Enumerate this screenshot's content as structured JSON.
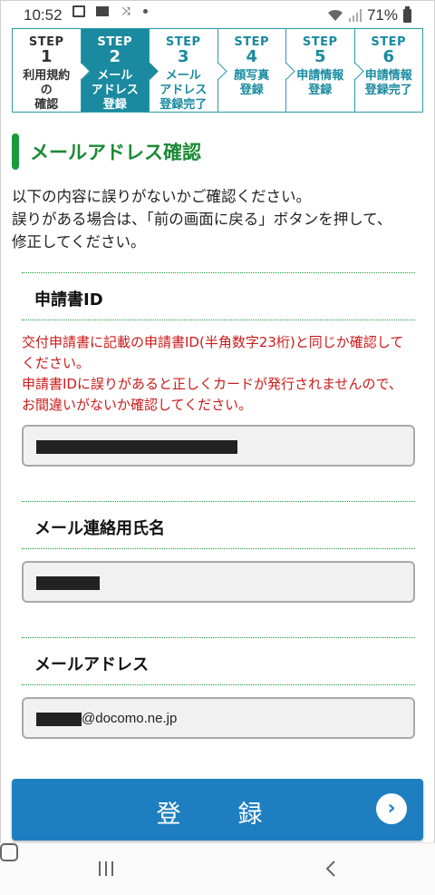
{
  "status": {
    "time": "10:52",
    "battery": "71%"
  },
  "steps": [
    {
      "label": "STEP",
      "number": "1",
      "text": [
        "利用規約",
        "の",
        "確認"
      ]
    },
    {
      "label": "STEP",
      "number": "2",
      "text": [
        "メール",
        "アドレス",
        "登録"
      ]
    },
    {
      "label": "STEP",
      "number": "3",
      "text": [
        "メール",
        "アドレス",
        "登録完了"
      ]
    },
    {
      "label": "STEP",
      "number": "4",
      "text": [
        "顔写真",
        "登録"
      ]
    },
    {
      "label": "STEP",
      "number": "5",
      "text": [
        "申請情報",
        "登録"
      ]
    },
    {
      "label": "STEP",
      "number": "6",
      "text": [
        "申請情報",
        "登録完了"
      ]
    }
  ],
  "page_title": "メールアドレス確認",
  "intro": [
    "以下の内容に誤りがないかご確認ください。",
    "誤りがある場合は、「前の画面に戻る」ボタンを押して、",
    "修正してください。"
  ],
  "fields": {
    "application_id": {
      "label": "申請書ID",
      "warning": [
        "交付申請書に記載の申請書ID(半角数字23桁)と同じか確認して",
        "ください。",
        "申請書IDに誤りがあると正しくカードが発行されませんので、",
        "お間違いがないか確認してください。"
      ]
    },
    "contact_name": {
      "label": "メール連絡用氏名"
    },
    "email": {
      "label": "メールアドレス",
      "domain_suffix": "@docomo.ne.jp"
    }
  },
  "submit": {
    "label": "登　録",
    "icon": "chevron-right-icon"
  },
  "colors": {
    "accent_teal": "#1a8aa0",
    "title_green": "#1b8a35",
    "warning_red": "#cc1a1a",
    "button_blue": "#1e7fc0"
  }
}
